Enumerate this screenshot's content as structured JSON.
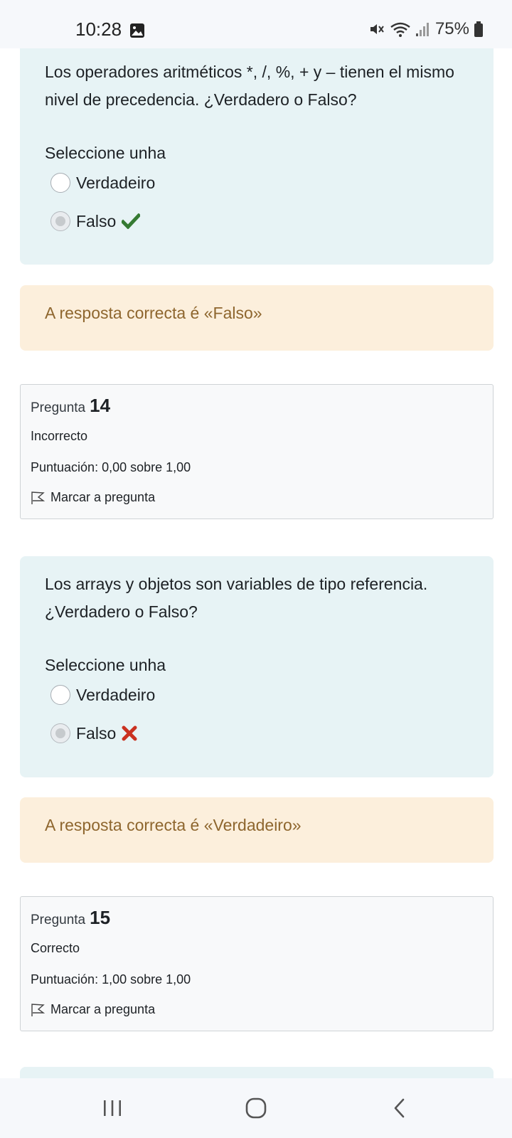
{
  "status_bar": {
    "time": "10:28",
    "battery": "75%",
    "icons": [
      "gallery-icon",
      "mute-icon",
      "wifi-icon",
      "signal-icon",
      "battery-icon"
    ]
  },
  "question_13": {
    "text": "Los operadores aritméticos *, /, %, + y – tienen el mismo nivel de precedencia. ¿Verdadero o Falso?",
    "prompt": "Seleccione unha",
    "options": [
      {
        "label": "Verdadeiro",
        "checked": false
      },
      {
        "label": "Falso",
        "checked": true,
        "mark": "check-icon"
      }
    ],
    "feedback": "A resposta correcta é «Falso»"
  },
  "question_14": {
    "label": "Pregunta",
    "number": "14",
    "state": "Incorrecto",
    "grade": "Puntuación: 0,00 sobre 1,00",
    "flag": "Marcar a pregunta",
    "text": "Los arrays y objetos son variables de tipo referencia. ¿Verdadero o Falso?",
    "prompt": "Seleccione unha",
    "options": [
      {
        "label": "Verdadeiro",
        "checked": false
      },
      {
        "label": "Falso",
        "checked": true,
        "mark": "cross-icon"
      }
    ],
    "feedback": "A resposta correcta é «Verdadeiro»"
  },
  "question_15": {
    "label": "Pregunta",
    "number": "15",
    "state": "Correcto",
    "grade": "Puntuación: 1,00 sobre 1,00",
    "flag": "Marcar a pregunta"
  },
  "colors": {
    "question_bg": "#e7f3f5",
    "feedback_bg": "#fcefdc",
    "feedback_text": "#8e662e",
    "correct": "#357a32",
    "incorrect": "#ca3120"
  },
  "nav_bar": {
    "icons": [
      "recent-apps-icon",
      "home-icon",
      "back-icon"
    ]
  }
}
